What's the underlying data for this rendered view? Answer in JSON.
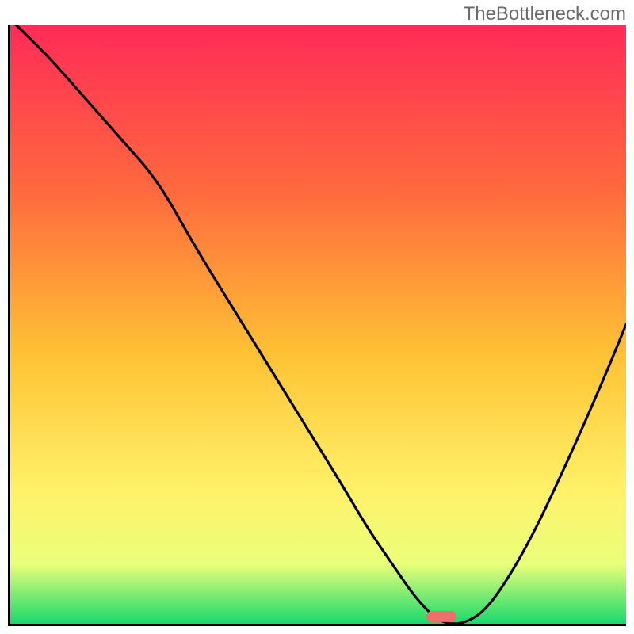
{
  "watermark": "TheBottleneck.com",
  "colors": {
    "gradient_top": "#ff2b58",
    "gradient_mid_upper": "#ff6a3d",
    "gradient_mid": "#ffc234",
    "gradient_mid_lower": "#fff26a",
    "gradient_lower": "#eaff7a",
    "gradient_bottom": "#17d96d",
    "line": "#000000",
    "marker": "#f06e6b"
  },
  "chart_data": {
    "type": "line",
    "title": "",
    "xlabel": "",
    "ylabel": "",
    "xlim": [
      0,
      100
    ],
    "ylim": [
      0,
      100
    ],
    "grid": false,
    "legend": false,
    "series": [
      {
        "name": "bottleneck-curve",
        "x": [
          0,
          6,
          12,
          18,
          24,
          30,
          36,
          42,
          48,
          54,
          58,
          62,
          66,
          70,
          74,
          78,
          84,
          90,
          96,
          100
        ],
        "y": [
          101,
          95,
          88,
          81,
          74,
          63,
          53,
          43,
          33,
          23,
          16,
          10,
          4,
          0,
          0,
          3,
          13,
          26,
          40,
          50
        ]
      }
    ],
    "marker": {
      "name": "optimal-point",
      "x": 70,
      "y": 1.2,
      "shape": "pill"
    },
    "annotations": []
  }
}
